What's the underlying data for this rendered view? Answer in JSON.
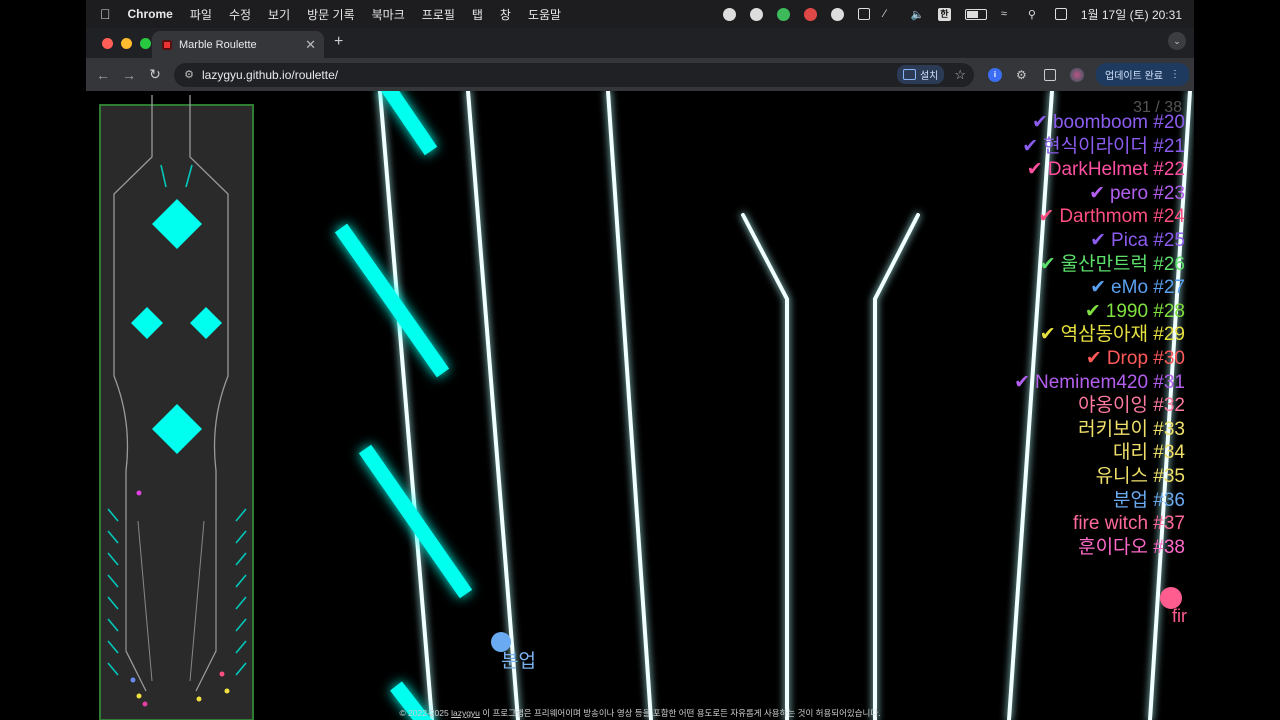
{
  "menubar": {
    "app_name": "Chrome",
    "menus": [
      "파일",
      "수정",
      "보기",
      "방문 기록",
      "북마크",
      "프로필",
      "탭",
      "창",
      "도움말"
    ],
    "input_source": "한",
    "clock": "1월 17일 (토) 20:31"
  },
  "browser": {
    "tab_title": "Marble Roulette",
    "url": "lazygyu.github.io/roulette/",
    "install_label": "설치",
    "update_label": "업데이트 완료",
    "extension_badge": "i"
  },
  "game": {
    "progress": "31 / 38",
    "ranking": [
      {
        "check": "✔",
        "name": "boomboom #20",
        "color": "#8c5cf0"
      },
      {
        "check": "✔",
        "name": "현식이라이더 #21",
        "color": "#8c5cf0"
      },
      {
        "check": "✔",
        "name": "DarkHelmet #22",
        "color": "#ff4fa0"
      },
      {
        "check": "✔",
        "name": "pero #23",
        "color": "#b45ff0"
      },
      {
        "check": "✔",
        "name": "Darthmom #24",
        "color": "#ff4f80"
      },
      {
        "check": "✔",
        "name": "Pica #25",
        "color": "#8c5cf0"
      },
      {
        "check": "✔",
        "name": "울산만트럭 #26",
        "color": "#5ce06a"
      },
      {
        "check": "✔",
        "name": "eMo #27",
        "color": "#5aa0f0"
      },
      {
        "check": "✔",
        "name": "1990 #28",
        "color": "#7fe040"
      },
      {
        "check": "✔",
        "name": "역삼동아재 #29",
        "color": "#e6e040"
      },
      {
        "check": "✔",
        "name": "Drop #30",
        "color": "#ff5a5a"
      },
      {
        "check": "✔",
        "name": "Neminem420 #31",
        "color": "#b45ff0"
      },
      {
        "check": "",
        "name": "야옹이잉 #32",
        "color": "#ff7aa0"
      },
      {
        "check": "",
        "name": "러키보이 #33",
        "color": "#f0e06a"
      },
      {
        "check": "",
        "name": "대리 #34",
        "color": "#f0e06a"
      },
      {
        "check": "",
        "name": "유니스 #35",
        "color": "#f0e06a"
      },
      {
        "check": "",
        "name": "분업 #36",
        "color": "#6aaaf0"
      },
      {
        "check": "",
        "name": "fire witch #37",
        "color": "#ff6a9a"
      },
      {
        "check": "",
        "name": "훈이다오 #38",
        "color": "#ff6aca"
      }
    ],
    "marble_label": "분업",
    "partial_label": "fir",
    "footer_prefix": "© 2022-2025",
    "footer_link": "lazygyu",
    "footer_text": "이 프로그램은 프리웨어이며 방송이나 영상 등을 포함한 어떤 용도로든 자유롭게 사용하는 것이 허용되어있습니다."
  },
  "colors": {
    "neon_cyan": "#00ffee",
    "rail_white": "#f0ffff",
    "minimap_border": "#2e7d32"
  }
}
